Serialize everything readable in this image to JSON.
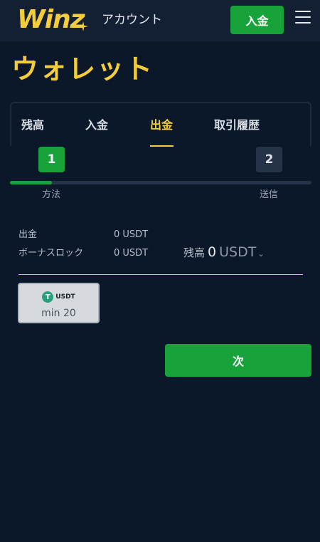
{
  "header": {
    "logo_text": "Winz",
    "account_label": "アカウント",
    "deposit_label": "入金",
    "menu_icon": "hamburger-menu-icon"
  },
  "page": {
    "title": "ウォレット"
  },
  "tabs": [
    {
      "label": "残高",
      "active": false
    },
    {
      "label": "入金",
      "active": false
    },
    {
      "label": "出金",
      "active": true
    },
    {
      "label": "取引履歴",
      "active": false
    }
  ],
  "steps": {
    "items": [
      {
        "number": "1",
        "label": "方法",
        "active": true
      },
      {
        "number": "2",
        "label": "送信",
        "active": false
      }
    ],
    "progress_fraction": 0.14
  },
  "info": {
    "withdraw_label": "出金",
    "withdraw_value": "0 USDT",
    "bonus_lock_label": "ボーナスロック",
    "bonus_lock_value": "0 USDT"
  },
  "balance": {
    "label": "残高",
    "amount": "0",
    "currency": "USDT"
  },
  "coin": {
    "symbol": "T",
    "name": "USDT",
    "min_label": "min 20",
    "icon": "tether-icon"
  },
  "next_button": {
    "label": "次"
  },
  "colors": {
    "background": "#0b1829",
    "header": "#131f33",
    "accent_yellow": "#f5cd3a",
    "accent_green": "#18a23a"
  }
}
